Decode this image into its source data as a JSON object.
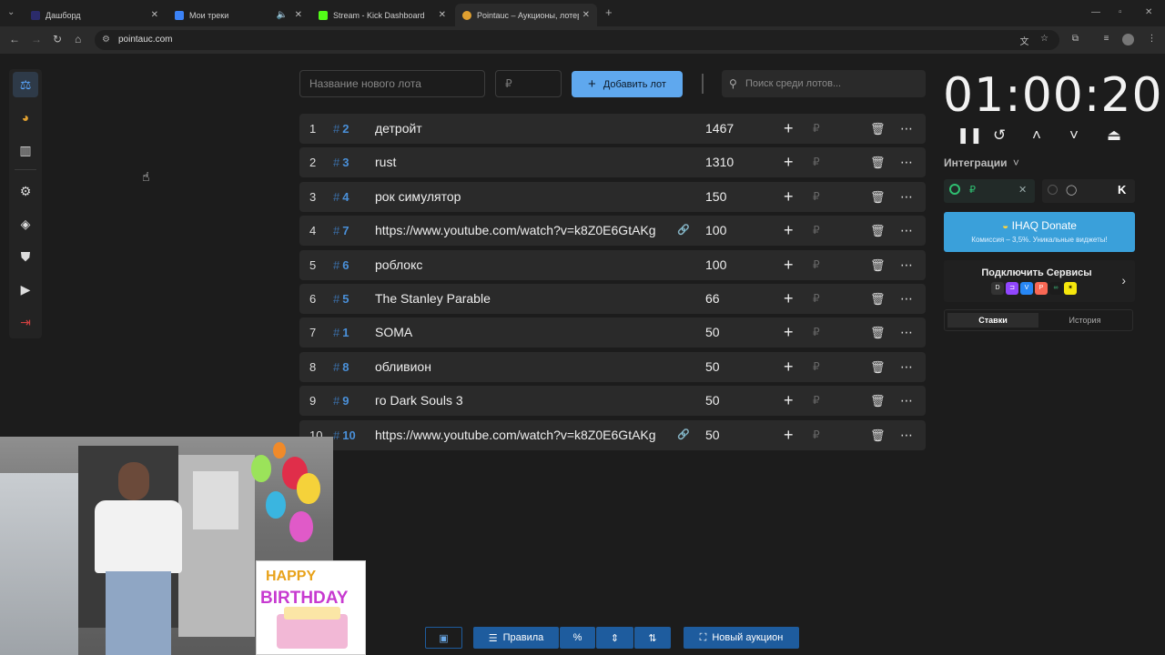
{
  "browser": {
    "tabs": [
      {
        "label": "Дашборд",
        "favicon_color": "#2b2b6b"
      },
      {
        "label": "Мои треки",
        "favicon_color": "#3b82f6"
      },
      {
        "label": "Stream - Kick Dashboard",
        "favicon_color": "#53fc18"
      },
      {
        "label": "Pointauc – Аукционы, лотерея",
        "favicon_color": "#e0a030"
      }
    ],
    "url": "pointauc.com"
  },
  "lot_form": {
    "name_placeholder": "Название нового лота",
    "amount_placeholder": "₽",
    "add_label": "Добавить лот",
    "search_placeholder": "Поиск среди лотов..."
  },
  "lots": [
    {
      "index": "1",
      "id": "2",
      "name": "детройт",
      "amount": "1467",
      "link": false
    },
    {
      "index": "2",
      "id": "3",
      "name": "rust",
      "amount": "1310",
      "link": false
    },
    {
      "index": "3",
      "id": "4",
      "name": "рок симулятор",
      "amount": "150",
      "link": false
    },
    {
      "index": "4",
      "id": "7",
      "name": "https://www.youtube.com/watch?v=k8Z0E6GtAKg",
      "amount": "100",
      "link": true
    },
    {
      "index": "5",
      "id": "6",
      "name": "роблокс",
      "amount": "100",
      "link": false
    },
    {
      "index": "6",
      "id": "5",
      "name": "The Stanley Parable",
      "amount": "66",
      "link": false
    },
    {
      "index": "7",
      "id": "1",
      "name": "SOMA",
      "amount": "50",
      "link": false
    },
    {
      "index": "8",
      "id": "8",
      "name": "обливион",
      "amount": "50",
      "link": false
    },
    {
      "index": "9",
      "id": "9",
      "name": "го Dark Souls 3",
      "amount": "50",
      "link": false
    },
    {
      "index": "10",
      "id": "10",
      "name": "https://www.youtube.com/watch?v=k8Z0E6GtAKg",
      "amount": "50",
      "link": true
    }
  ],
  "row_symbols": {
    "hash": "#",
    "currency": "₽"
  },
  "timer": {
    "value": "01:00:20"
  },
  "integrations": {
    "label": "Интеграции"
  },
  "donate": {
    "title": "IHAQ Donate",
    "subtitle": "Комиссия – 3,5%. Уникальные виджеты!"
  },
  "services": {
    "label": "Подключить Сервисы"
  },
  "panel_tabs": {
    "bids": "Ставки",
    "history": "История"
  },
  "bottom_bar": {
    "rules_label": "Правила",
    "percent_label": "%",
    "new_auction_label": "Новый аукцион"
  },
  "overlay": {
    "line1": "HAPPY",
    "line2": "BIRTHDAY"
  },
  "colors": {
    "accent": "#5fa8ee",
    "donate": "#3aa0da",
    "toolbar": "#1e5c9e"
  }
}
